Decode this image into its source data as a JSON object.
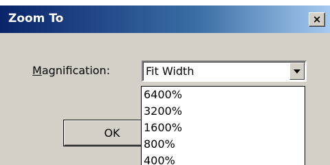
{
  "dialog": {
    "title": "Zoom To",
    "close_glyph": "×",
    "magnification_label_mnemonic": "M",
    "magnification_label_rest": "agnification:",
    "magnification_value": "Fit Width",
    "ok_label": "OK"
  },
  "dropdown": {
    "items": [
      "6400%",
      "3200%",
      "1600%",
      "800%",
      "400%"
    ]
  },
  "colors": {
    "titlebar_start": "#0a246a",
    "titlebar_end": "#a6caf0",
    "face": "#d4d0c8"
  },
  "icons": {
    "close": "close-icon",
    "dropdown_arrow": "chevron-down-icon"
  }
}
